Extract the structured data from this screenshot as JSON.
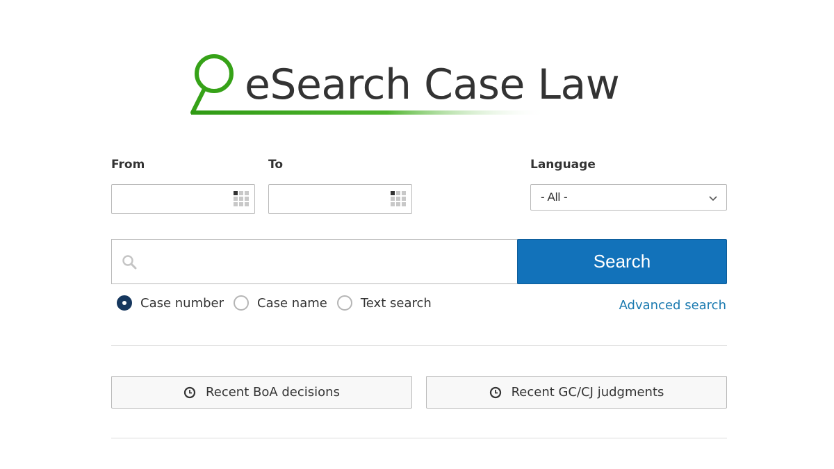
{
  "logo": {
    "title": "eSearch Case Law",
    "brand_color": "#3aa61e"
  },
  "filters": {
    "from_label": "From",
    "to_label": "To",
    "language_label": "Language",
    "from_value": "",
    "to_value": "",
    "language_value": "- All -"
  },
  "search": {
    "query_value": "",
    "button_label": "Search",
    "button_color": "#1272ba"
  },
  "search_modes": [
    {
      "label": "Case number",
      "checked": true
    },
    {
      "label": "Case name",
      "checked": false
    },
    {
      "label": "Text search",
      "checked": false
    }
  ],
  "advanced_search_label": "Advanced search",
  "recent": {
    "boa_label": "Recent BoA decisions",
    "gc_label": "Recent GC/CJ judgments"
  },
  "icons": {
    "logo": "magnifier-logo-icon",
    "calendar": "calendar-icon",
    "search": "search-icon",
    "dropdown": "chevron-down-icon",
    "clock": "clock-icon"
  }
}
